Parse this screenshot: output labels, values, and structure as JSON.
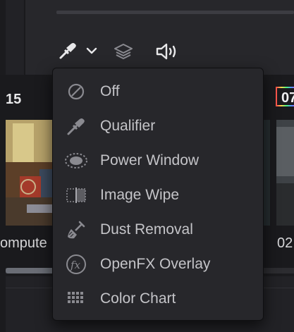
{
  "toolbar": {
    "icons": [
      "eyedropper-icon",
      "chevron-down-icon",
      "layers-icon",
      "speaker-icon"
    ]
  },
  "clips": {
    "left_number": "15",
    "right_number": "07",
    "left_name": "ompute",
    "right_name": "02"
  },
  "menu": {
    "items": [
      {
        "label": "Off",
        "icon": "off-circle-slash-icon"
      },
      {
        "label": "Qualifier",
        "icon": "eyedropper-icon"
      },
      {
        "label": "Power Window",
        "icon": "power-window-icon"
      },
      {
        "label": "Image Wipe",
        "icon": "image-wipe-icon"
      },
      {
        "label": "Dust Removal",
        "icon": "brush-icon"
      },
      {
        "label": "OpenFX Overlay",
        "icon": "fx-icon"
      },
      {
        "label": "Color Chart",
        "icon": "color-chart-grid-icon"
      }
    ]
  },
  "colors": {
    "menu_bg": "#27272b",
    "menu_text": "#c4c4c8",
    "icon_gray": "#8a8a90",
    "toolbar_icon": "#e6e6e8"
  }
}
